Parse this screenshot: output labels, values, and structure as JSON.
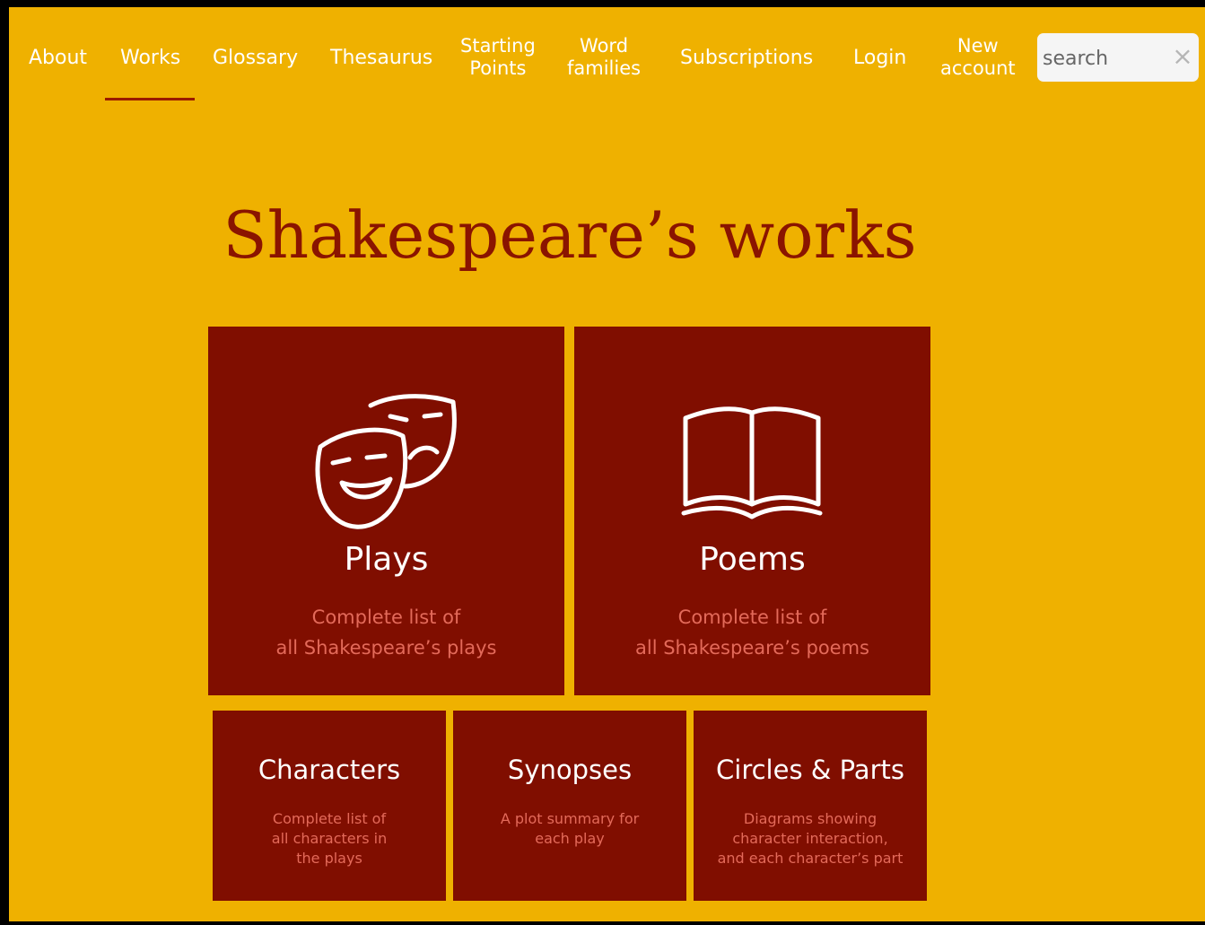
{
  "nav": {
    "about": "About",
    "works": "Works",
    "glossary": "Glossary",
    "thesaurus": "Thesaurus",
    "starting_points": [
      "Starting",
      "Points"
    ],
    "word_families": [
      "Word",
      "families"
    ],
    "subscriptions": "Subscriptions",
    "login": "Login",
    "new_account": [
      "New",
      "account"
    ],
    "active": "Works"
  },
  "search": {
    "placeholder": "search",
    "clear_icon": "×"
  },
  "page_title": "Shakespeare’s works",
  "cards": {
    "plays": {
      "title": "Plays",
      "desc": [
        "Complete list of",
        "all Shakespeare’s plays"
      ],
      "icon": "theatre-masks-icon"
    },
    "poems": {
      "title": "Poems",
      "desc": [
        "Complete list of",
        "all Shakespeare’s poems"
      ],
      "icon": "open-book-icon"
    },
    "characters": {
      "title": "Characters",
      "desc": [
        "Complete list of",
        "all characters in",
        "the plays"
      ]
    },
    "synopses": {
      "title": "Synopses",
      "desc": [
        "A plot summary for",
        "each play"
      ]
    },
    "circles_parts": {
      "title": "Circles & Parts",
      "desc": [
        "Diagrams showing",
        "character interaction,",
        "and each character’s part"
      ]
    }
  },
  "colors": {
    "page_background": "#efb100",
    "card_background": "#800e00",
    "title_color": "#8a1400",
    "description_color": "#e36a5a",
    "active_underline": "#9a1a00"
  }
}
